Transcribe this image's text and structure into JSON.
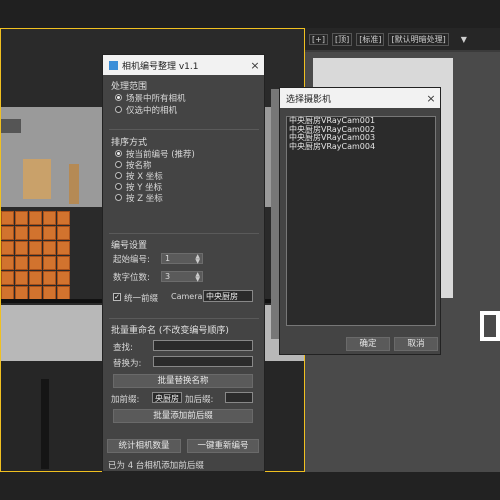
{
  "viewport": {
    "right_header": [
      "[+]",
      "[顶]",
      "[标准]",
      "[默认明暗处理]"
    ]
  },
  "main_dialog": {
    "title": "相机编号整理 v1.1",
    "scope": {
      "title": "处理范围",
      "options": [
        {
          "label": "场景中所有相机",
          "selected": true
        },
        {
          "label": "仅选中的相机",
          "selected": false
        }
      ]
    },
    "sort": {
      "title": "排序方式",
      "options": [
        {
          "label": "按当前编号 (推荐)",
          "selected": true
        },
        {
          "label": "按名称",
          "selected": false
        },
        {
          "label": "按 X 坐标",
          "selected": false
        },
        {
          "label": "按 Y 坐标",
          "selected": false
        },
        {
          "label": "按 Z 坐标",
          "selected": false
        }
      ]
    },
    "numbering": {
      "title": "编号设置",
      "start_label": "起始编号:",
      "start_value": "1",
      "digits_label": "数字位数:",
      "digits_value": "3",
      "unify_label": "统一前缀",
      "unify_checked": true,
      "prefix_static": "Camera",
      "prefix_value": "中央厨房"
    },
    "rename": {
      "title": "批量重命名 (不改变编号顺序)",
      "find_label": "查找:",
      "find_value": "",
      "replace_label": "替换为:",
      "replace_value": "",
      "replace_button": "批量替换名称",
      "add_prefix_label": "加前缀:",
      "add_prefix_value": "央厨房",
      "add_suffix_label": "加后缀:",
      "add_suffix_value": "",
      "add_button": "批量添加前后缀"
    },
    "count_button": "统计相机数量",
    "renumber_button": "一键重新编号",
    "status": "已为 4 台相机添加前后缀"
  },
  "select_dialog": {
    "title": "选择摄影机",
    "cameras": [
      "中央厨房VRayCam001",
      "中央厨房VRayCam002",
      "中央厨房VRayCam003",
      "中央厨房VRayCam004"
    ],
    "ok_button": "确定",
    "cancel_button": "取消"
  }
}
